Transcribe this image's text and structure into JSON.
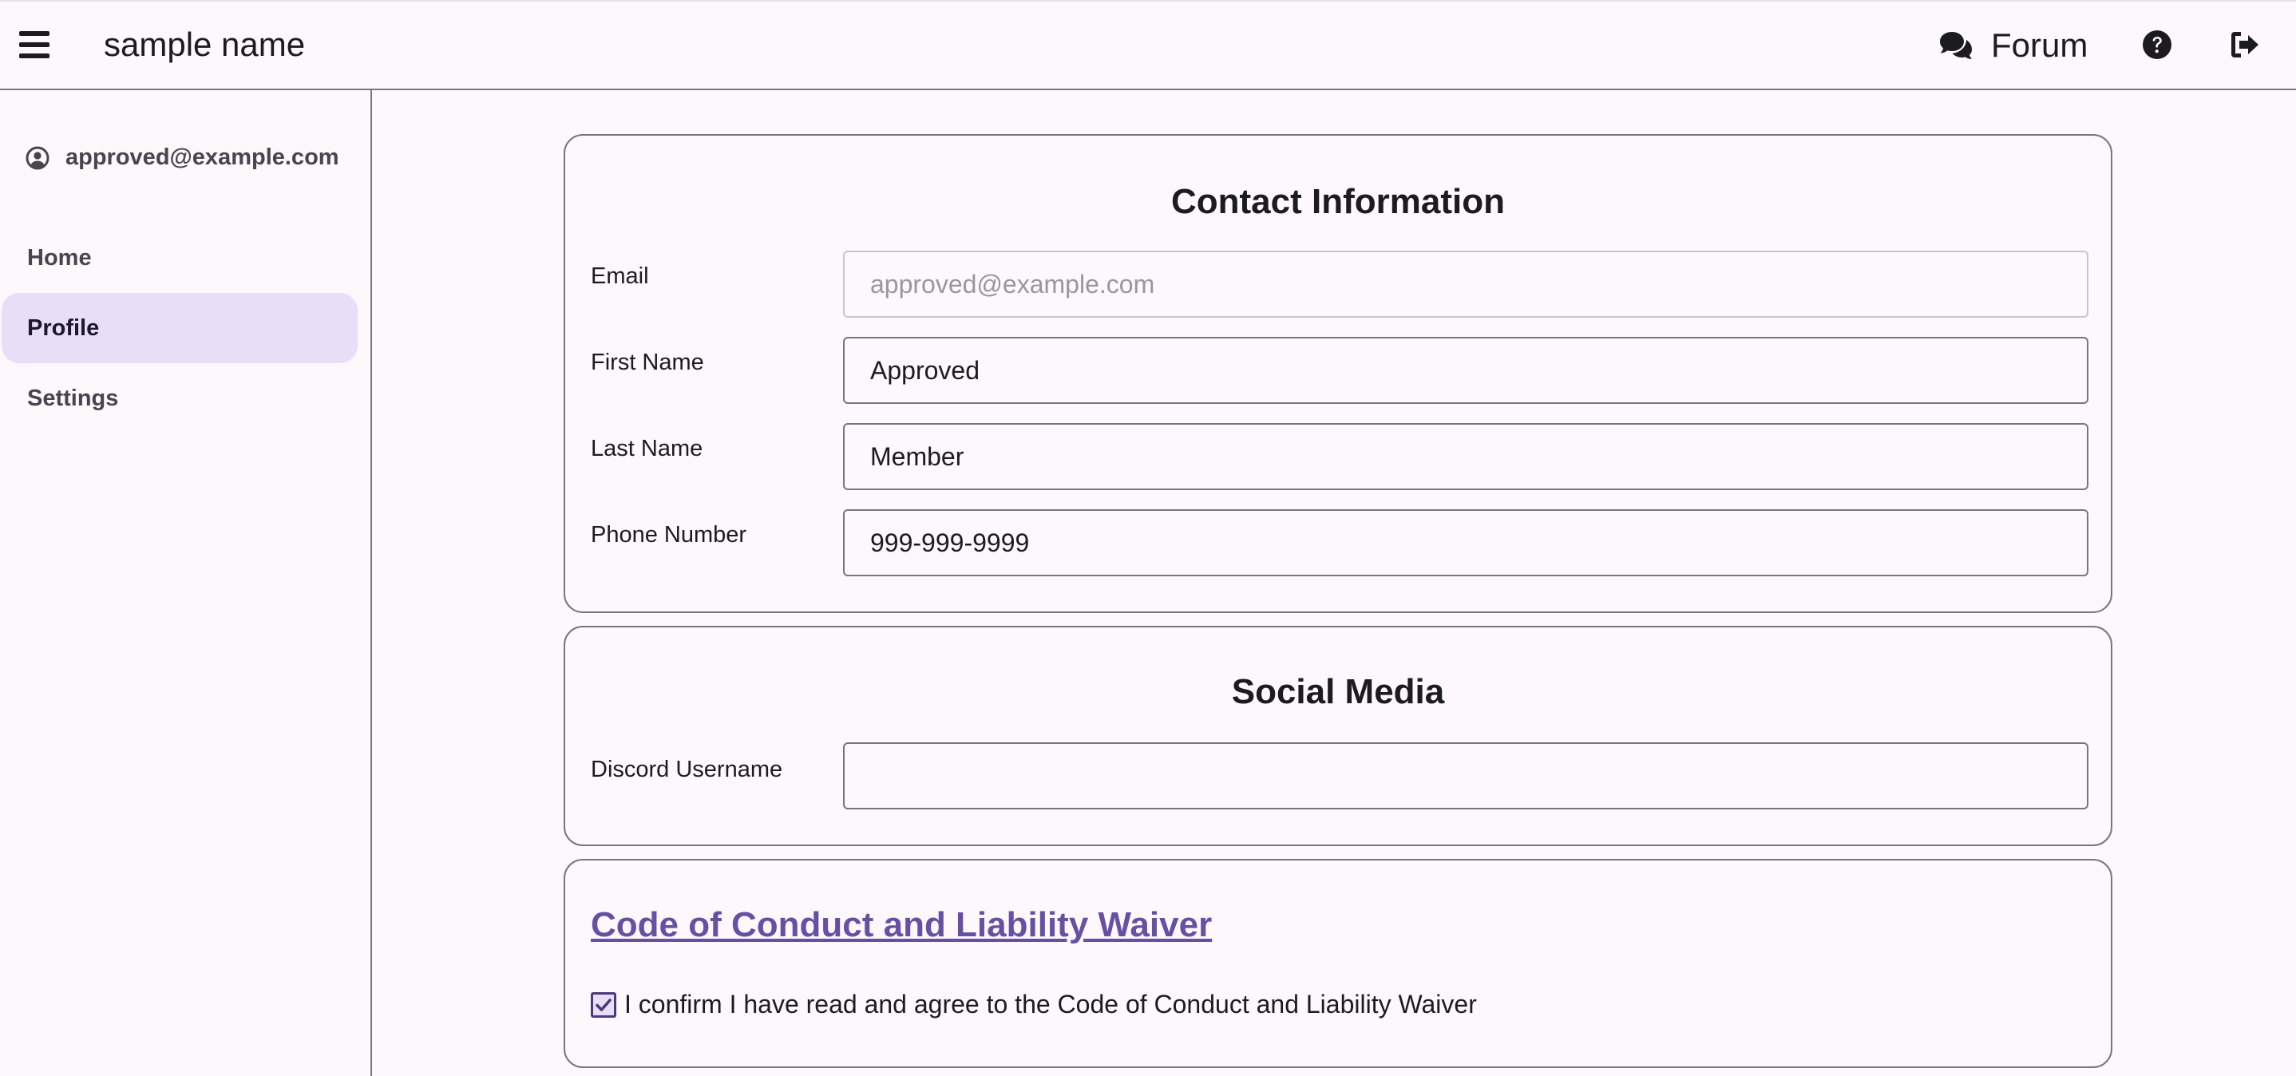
{
  "header": {
    "app_title": "sample name",
    "forum_label": "Forum"
  },
  "sidebar": {
    "user_email": "approved@example.com",
    "items": [
      {
        "label": "Home",
        "active": false
      },
      {
        "label": "Profile",
        "active": true
      },
      {
        "label": "Settings",
        "active": false
      }
    ]
  },
  "contact": {
    "title": "Contact Information",
    "email_label": "Email",
    "email_placeholder": "approved@example.com",
    "first_name_label": "First Name",
    "first_name_value": "Approved",
    "last_name_label": "Last Name",
    "last_name_value": "Member",
    "phone_label": "Phone Number",
    "phone_value": "999-999-9999"
  },
  "social": {
    "title": "Social Media",
    "discord_label": "Discord Username",
    "discord_value": ""
  },
  "waiver": {
    "link_text": "Code of Conduct and Liability Waiver",
    "confirm_text": "I confirm I have read and agree to the Code of Conduct and Liability Waiver",
    "checked": true
  },
  "colors": {
    "accent": "#6750a4",
    "active_nav_bg": "#e8def8",
    "background": "#fcf8fc",
    "border": "#79747e"
  },
  "icons": {
    "menu": "hamburger-menu-icon",
    "forum": "comments-icon",
    "help": "question-circle-icon",
    "logout": "sign-out-icon",
    "user": "user-circle-icon",
    "checkbox": "check-icon"
  }
}
